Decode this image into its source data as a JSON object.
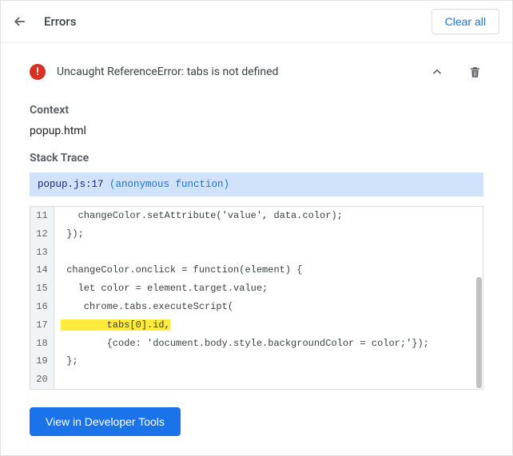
{
  "header": {
    "title": "Errors",
    "clear_all": "Clear all"
  },
  "error": {
    "message": "Uncaught ReferenceError: tabs is not defined"
  },
  "context": {
    "label": "Context",
    "value": "popup.html"
  },
  "stack": {
    "label": "Stack Trace",
    "file": "popup.js:17",
    "fn": " (anonymous function)"
  },
  "code": {
    "lines": [
      {
        "n": "11",
        "t": "   changeColor.setAttribute('value', data.color);",
        "hl": false
      },
      {
        "n": "12",
        "t": " });",
        "hl": false
      },
      {
        "n": "13",
        "t": "",
        "hl": false
      },
      {
        "n": "14",
        "t": " changeColor.onclick = function(element) {",
        "hl": false
      },
      {
        "n": "15",
        "t": "   let color = element.target.value;",
        "hl": false
      },
      {
        "n": "16",
        "t": "    chrome.tabs.executeScript(",
        "hl": false
      },
      {
        "n": "17",
        "t": "        tabs[0].id,",
        "hl": true
      },
      {
        "n": "18",
        "t": "        {code: 'document.body.style.backgroundColor = color;'});",
        "hl": false
      },
      {
        "n": "19",
        "t": " };",
        "hl": false
      },
      {
        "n": "20",
        "t": "",
        "hl": false
      }
    ]
  },
  "footer": {
    "view_devtools": "View in Developer Tools"
  },
  "icons": {
    "error_mark": "!"
  }
}
